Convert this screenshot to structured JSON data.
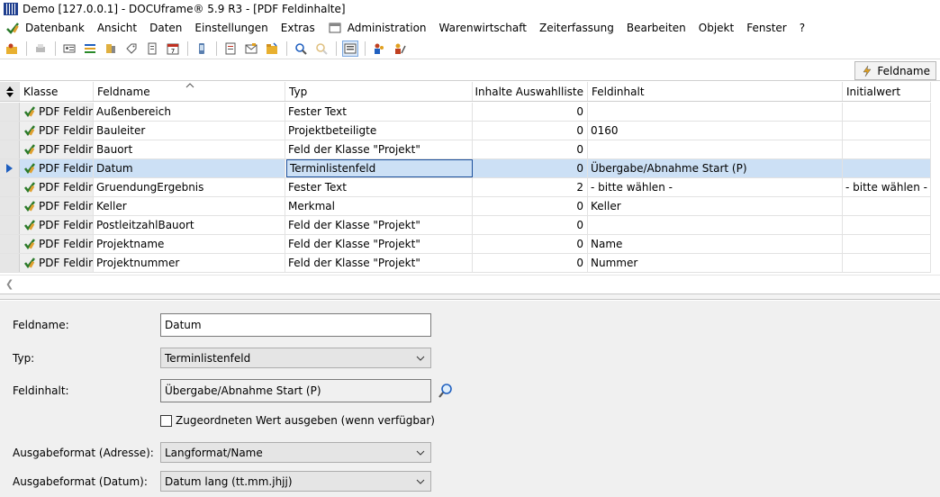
{
  "window": {
    "title": "Demo [127.0.0.1] - DOCUframe® 5.9 R3 - [PDF Feldinhalte]"
  },
  "menu": {
    "items": [
      "Datenbank",
      "Ansicht",
      "Daten",
      "Einstellungen",
      "Extras",
      "Administration",
      "Warenwirtschaft",
      "Zeiterfassung",
      "Bearbeiten",
      "Objekt",
      "Fenster",
      "?"
    ]
  },
  "group_bar": {
    "sort_label": "Feldname"
  },
  "grid": {
    "columns": [
      "Klasse",
      "Feldname",
      "Typ",
      "Inhalte Auswahlliste",
      "Feldinhalt",
      "Initialwert"
    ],
    "rows": [
      {
        "klasse": "PDF Feldin",
        "feldname": "Außenbereich",
        "typ": "Fester Text",
        "inhalte": "0",
        "feldinhalt": "",
        "initialwert": ""
      },
      {
        "klasse": "PDF Feldin",
        "feldname": "Bauleiter",
        "typ": "Projektbeteiligte",
        "inhalte": "0",
        "feldinhalt": "0160",
        "initialwert": ""
      },
      {
        "klasse": "PDF Feldin",
        "feldname": "Bauort",
        "typ": "Feld der Klasse \"Projekt\"",
        "inhalte": "0",
        "feldinhalt": "",
        "initialwert": ""
      },
      {
        "klasse": "PDF Feldin",
        "feldname": "Datum",
        "typ": "Terminlistenfeld",
        "inhalte": "0",
        "feldinhalt": "Übergabe/Abnahme Start (P)",
        "initialwert": ""
      },
      {
        "klasse": "PDF Feldin",
        "feldname": "GruendungErgebnis",
        "typ": "Fester Text",
        "inhalte": "2",
        "feldinhalt": "- bitte wählen -",
        "initialwert": "- bitte wählen -"
      },
      {
        "klasse": "PDF Feldin",
        "feldname": "Keller",
        "typ": "Merkmal",
        "inhalte": "0",
        "feldinhalt": "Keller",
        "initialwert": ""
      },
      {
        "klasse": "PDF Feldin",
        "feldname": "PostleitzahlBauort",
        "typ": "Feld der Klasse \"Projekt\"",
        "inhalte": "0",
        "feldinhalt": "",
        "initialwert": ""
      },
      {
        "klasse": "PDF Feldin",
        "feldname": "Projektname",
        "typ": "Feld der Klasse \"Projekt\"",
        "inhalte": "0",
        "feldinhalt": "Name",
        "initialwert": ""
      },
      {
        "klasse": "PDF Feldin",
        "feldname": "Projektnummer",
        "typ": "Feld der Klasse \"Projekt\"",
        "inhalte": "0",
        "feldinhalt": "Nummer",
        "initialwert": ""
      }
    ],
    "selected_row": 3
  },
  "form": {
    "feldname_label": "Feldname:",
    "feldname_value": "Datum",
    "typ_label": "Typ:",
    "typ_value": "Terminlistenfeld",
    "feldinhalt_label": "Feldinhalt:",
    "feldinhalt_value": "Übergabe/Abnahme Start (P)",
    "checkbox_label": "Zugeordneten Wert ausgeben (wenn verfügbar)",
    "ausgabe_adresse_label": "Ausgabeformat (Adresse):",
    "ausgabe_adresse_value": "Langformat/Name",
    "ausgabe_datum_label": "Ausgabeformat (Datum):",
    "ausgabe_datum_value": "Datum lang (tt.mm.jhjj)"
  },
  "colors": {
    "selection": "#cce0f5",
    "accent": "#1f5fbf",
    "panel": "#f0f0f0"
  }
}
